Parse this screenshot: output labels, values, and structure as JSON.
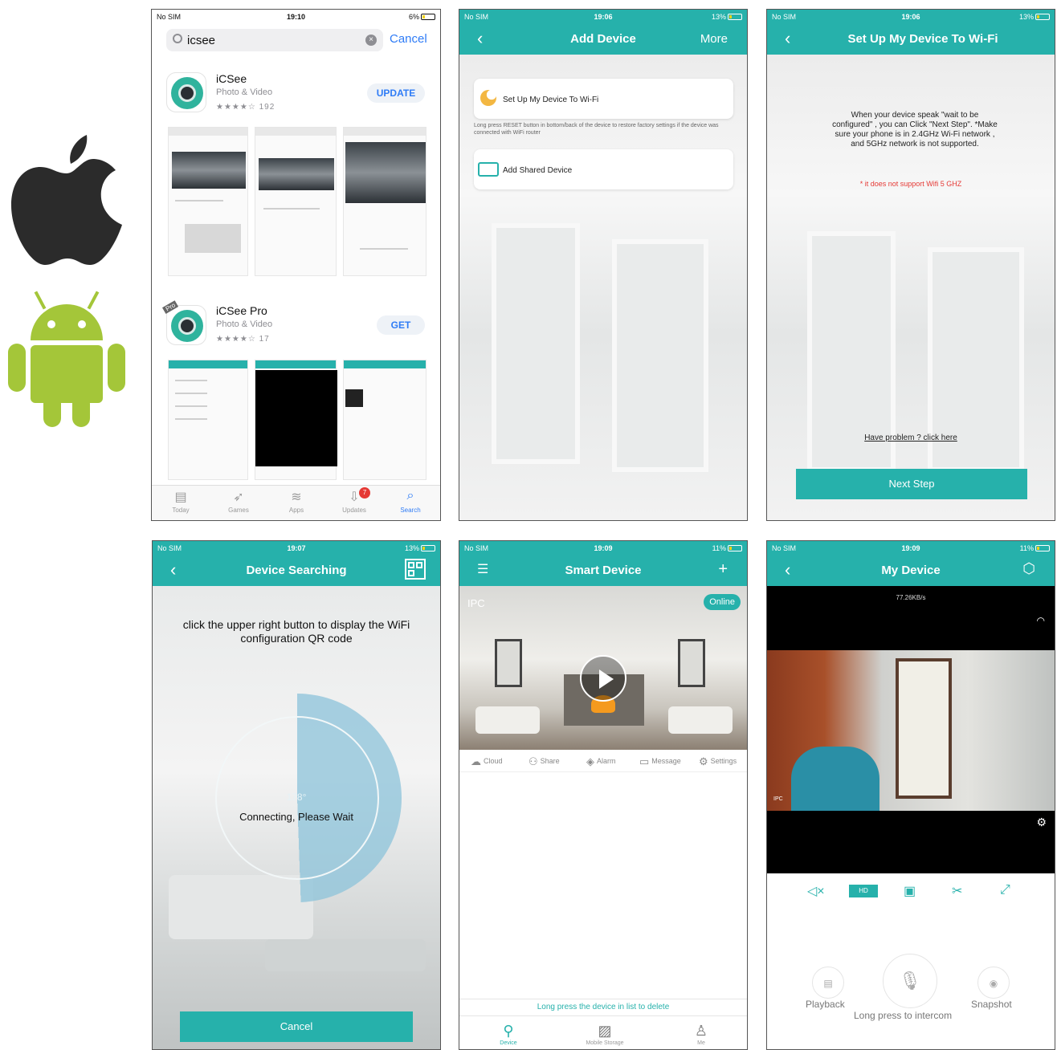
{
  "platforms": {
    "apple": "apple-logo-icon",
    "android": "android-logo-icon"
  },
  "colors": {
    "accent": "#26b1ab",
    "ios_blue": "#2f7cf6",
    "warning": "#e53935"
  },
  "app_store": {
    "status": {
      "carrier": "No SIM",
      "time": "19:10",
      "battery": "6%"
    },
    "search_text": "icsee",
    "cancel": "Cancel",
    "results": [
      {
        "name": "iCSee",
        "category": "Photo & Video",
        "stars": "★★★★☆",
        "rating_count": "192",
        "action": "UPDATE"
      },
      {
        "name": "iCSee Pro",
        "category": "Photo & Video",
        "stars": "★★★★☆",
        "rating_count": "17",
        "action": "GET",
        "ribbon": "Pro"
      }
    ],
    "tabs": [
      {
        "label": "Today",
        "icon": "today-icon"
      },
      {
        "label": "Games",
        "icon": "rocket-icon"
      },
      {
        "label": "Apps",
        "icon": "layers-icon"
      },
      {
        "label": "Updates",
        "icon": "download-icon",
        "badge": "7"
      },
      {
        "label": "Search",
        "icon": "search-icon"
      }
    ]
  },
  "add_device": {
    "status": {
      "carrier": "No SIM",
      "time": "19:06",
      "battery": "13%"
    },
    "title": "Add Device",
    "more": "More",
    "option_wifi": "Set Up My Device To Wi-Fi",
    "wifi_hint": "Long press RESET button in bottom/back of the device to restore factory settings if the device was connected with WiFi router",
    "option_shared": "Add Shared Device"
  },
  "setup_wifi": {
    "status": {
      "carrier": "No SIM",
      "time": "19:06",
      "battery": "13%"
    },
    "title": "Set Up My Device To Wi-Fi",
    "instructions": "When your device speak \"wait to be configured\" , you can Click \"Next Step\". *Make sure your phone is in 2.4GHz Wi-Fi network , and 5GHz network is not supported.",
    "note": "* it does not support Wifi 5 GHZ",
    "problem_link": "Have problem ? click here",
    "next": "Next Step"
  },
  "device_search": {
    "status": {
      "carrier": "No SIM",
      "time": "19:07",
      "battery": "13%"
    },
    "title": "Device Searching",
    "instructions": "click the upper right button to display the WiFi configuration QR code",
    "degree": "178°",
    "connecting": "Connecting, Please Wait",
    "cancel": "Cancel"
  },
  "smart_device": {
    "status": {
      "carrier": "No SIM",
      "time": "19:09",
      "battery": "11%"
    },
    "title": "Smart Device",
    "device_label": "IPC",
    "online": "Online",
    "actions": [
      "Cloud",
      "Share",
      "Alarm",
      "Message",
      "Settings"
    ],
    "delete_hint": "Long press the device in list to delete",
    "tabs": [
      "Device",
      "Mobile Storage",
      "Me"
    ]
  },
  "my_device": {
    "status": {
      "carrier": "No SIM",
      "time": "19:09",
      "battery": "11%"
    },
    "title": "My Device",
    "speed": "77.26KB/s",
    "ipc": "IPC",
    "hd": "HD",
    "playback": "Playback",
    "snapshot": "Snapshot",
    "intercom": "Long press to intercom"
  }
}
